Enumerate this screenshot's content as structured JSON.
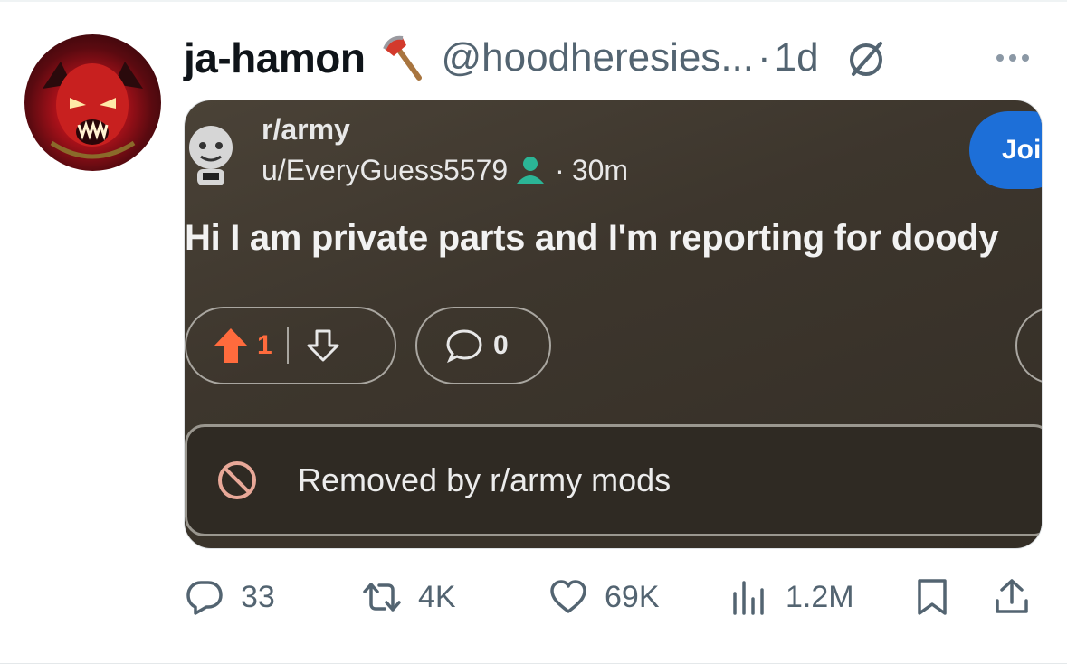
{
  "tweet": {
    "display_name": "ja-hamon",
    "handle": "@hoodheresies...",
    "separator": "·",
    "time": "1d",
    "embedded_post": {
      "subreddit": "r/army",
      "author": "u/EveryGuess5579",
      "separator": "·",
      "age": "30m",
      "join_label": "Joi",
      "title": "Hi I am private parts and I'm reporting for doody",
      "upvotes": "1",
      "comments": "0",
      "removed_notice": "Removed by r/army mods"
    },
    "stats": {
      "replies": "33",
      "reposts": "4K",
      "likes": "69K",
      "views": "1.2M"
    }
  },
  "colors": {
    "handle_gray": "#536471",
    "join_blue": "#1d6fd8",
    "upvote_orange": "#ff6b3d",
    "card_bg": "#3d362d"
  },
  "icons": [
    "axe-emoji-icon",
    "grok-icon",
    "more-icon",
    "snoo-avatar-icon",
    "person-icon",
    "upvote-icon",
    "downvote-icon",
    "comment-bubble-icon",
    "removed-icon",
    "reply-icon",
    "repost-icon",
    "like-icon",
    "views-icon",
    "bookmark-icon",
    "share-icon"
  ]
}
